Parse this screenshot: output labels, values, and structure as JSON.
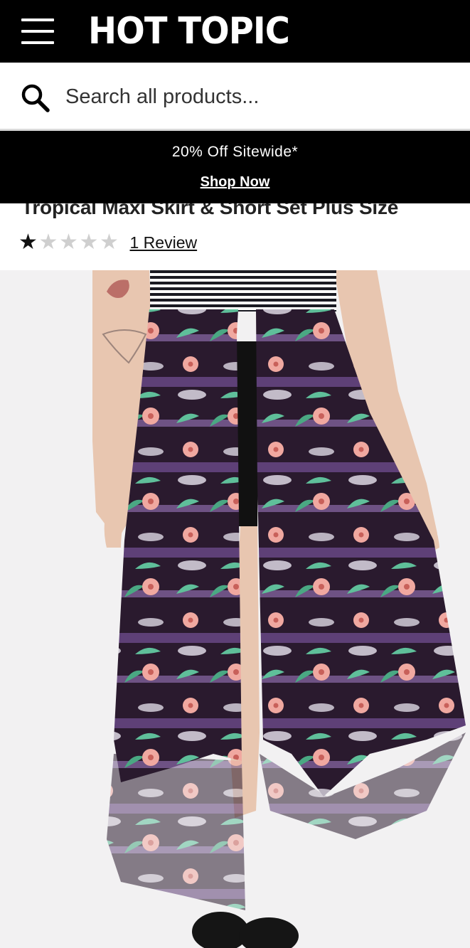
{
  "header": {
    "logo_text": "HOT TOPIC",
    "menu_icon": "hamburger-menu-icon",
    "background": "#000000"
  },
  "search": {
    "placeholder": "Search all products...",
    "icon": "search-icon"
  },
  "promo": {
    "text": "20% Off Sitewide*",
    "link_label": "Shop Now",
    "background": "#000000"
  },
  "product": {
    "title": "Tropical Maxi Skirt & Short Set Plus Size",
    "rating": 1,
    "rating_max": 5,
    "review_label": "1 Review",
    "image_alt": "Tropical print maxi skirt with black shorts"
  },
  "colors": {
    "skirt_base": "#2a1a2e",
    "leaf": "#5fbf9a",
    "flower": "#f0a8a0",
    "purple": "#6b4a8a"
  }
}
